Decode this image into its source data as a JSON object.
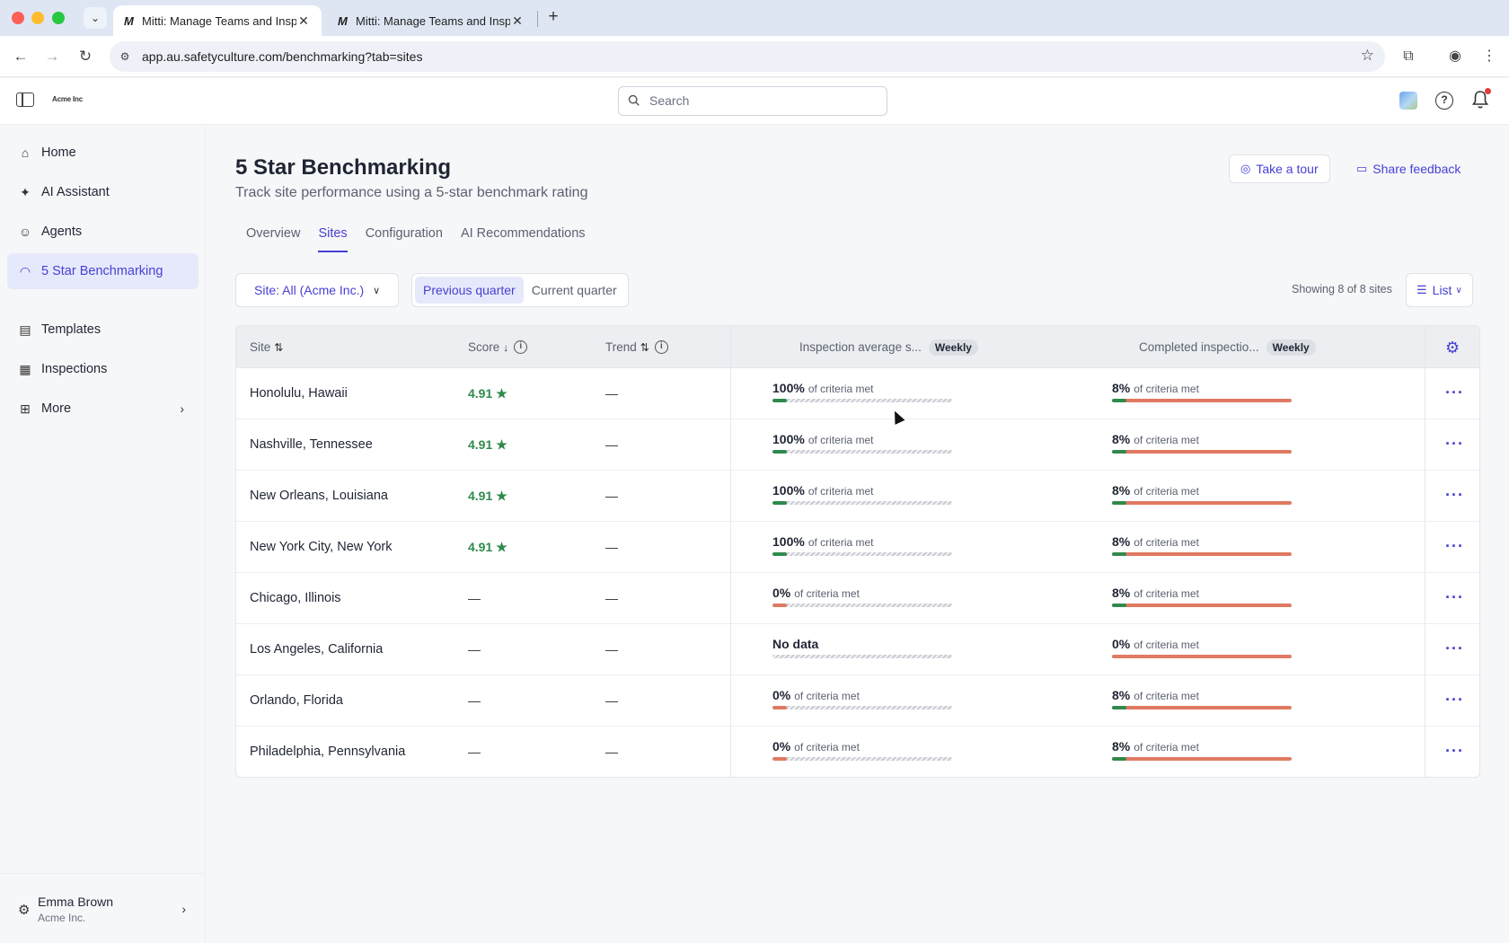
{
  "browser": {
    "tabs": [
      {
        "favicon": "M",
        "title": "Mitti: Manage Teams and Insp",
        "active": true
      },
      {
        "favicon": "M",
        "title": "Mitti: Manage Teams and Insp",
        "active": false
      }
    ],
    "url": "app.au.safetyculture.com/benchmarking?tab=sites"
  },
  "header": {
    "logo": "Acme Inc",
    "search_placeholder": "Search"
  },
  "sidebar": {
    "items": [
      {
        "label": "Home",
        "icon": "home-icon"
      },
      {
        "label": "AI Assistant",
        "icon": "sparkle-icon"
      },
      {
        "label": "Agents",
        "icon": "robot-icon"
      },
      {
        "label": "5 Star Benchmarking",
        "icon": "gauge-icon",
        "active": true
      },
      {
        "label": "Templates",
        "icon": "template-icon"
      },
      {
        "label": "Inspections",
        "icon": "clipboard-icon"
      },
      {
        "label": "More",
        "icon": "grid-icon"
      }
    ],
    "user": {
      "name": "Emma Brown",
      "org": "Acme Inc."
    }
  },
  "page": {
    "title": "5 Star Benchmarking",
    "subtitle": "Track site performance using a 5-star benchmark rating",
    "take_tour": "Take a tour",
    "share_feedback": "Share feedback",
    "tabs": [
      "Overview",
      "Sites",
      "Configuration",
      "AI Recommendations"
    ],
    "active_tab": "Sites",
    "site_filter": "Site: All (Acme Inc.)",
    "period_options": [
      "Previous quarter",
      "Current quarter"
    ],
    "active_period": "Previous quarter",
    "showing": "Showing 8 of 8 sites",
    "view_mode": "List"
  },
  "table": {
    "columns": {
      "site": "Site",
      "score": "Score",
      "trend": "Trend",
      "inspection_avg": "Inspection average s...",
      "inspection_avg_badge": "Weekly",
      "completed": "Completed inspectio...",
      "completed_badge": "Weekly"
    },
    "criteria_suffix": "of criteria met",
    "no_data": "No data",
    "rows": [
      {
        "site": "Honolulu, Hawaii",
        "score": "4.91",
        "trend": "—",
        "insp": "100%",
        "insp_fraction": 0.08,
        "comp": "8%",
        "comp_fraction": 0.08
      },
      {
        "site": "Nashville, Tennessee",
        "score": "4.91",
        "trend": "—",
        "insp": "100%",
        "insp_fraction": 0.08,
        "comp": "8%",
        "comp_fraction": 0.08
      },
      {
        "site": "New Orleans, Louisiana",
        "score": "4.91",
        "trend": "—",
        "insp": "100%",
        "insp_fraction": 0.08,
        "comp": "8%",
        "comp_fraction": 0.08
      },
      {
        "site": "New York City, New York",
        "score": "4.91",
        "trend": "—",
        "insp": "100%",
        "insp_fraction": 0.08,
        "comp": "8%",
        "comp_fraction": 0.08
      },
      {
        "site": "Chicago, Illinois",
        "score": "—",
        "trend": "—",
        "insp": "0%",
        "insp_fraction": 0.08,
        "comp": "8%",
        "comp_fraction": 0.08
      },
      {
        "site": "Los Angeles, California",
        "score": "—",
        "trend": "—",
        "insp": null,
        "insp_fraction": 0,
        "comp": "0%",
        "comp_fraction": 0
      },
      {
        "site": "Orlando, Florida",
        "score": "—",
        "trend": "—",
        "insp": "0%",
        "insp_fraction": 0.08,
        "comp": "8%",
        "comp_fraction": 0.08
      },
      {
        "site": "Philadelphia, Pennsylvania",
        "score": "—",
        "trend": "—",
        "insp": "0%",
        "insp_fraction": 0.08,
        "comp": "8%",
        "comp_fraction": 0.08
      }
    ]
  },
  "colors": {
    "accent": "#4740d4",
    "good": "#2f8a4d",
    "bad": "#e07a62"
  }
}
